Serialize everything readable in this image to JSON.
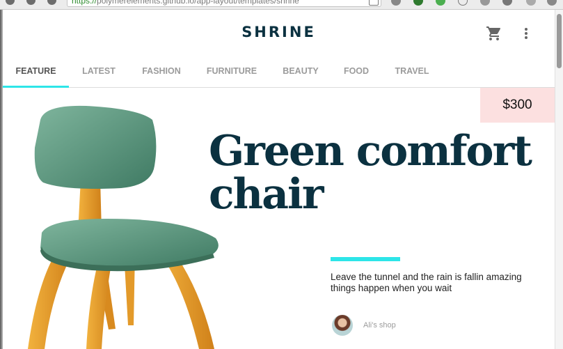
{
  "browser": {
    "url_scheme": "https://",
    "url_rest": "polymerelements.github.io/app-layout/templates/shrine"
  },
  "header": {
    "logo": "SHRINE",
    "cart_icon": "cart-icon",
    "more_icon": "more-vert-icon"
  },
  "tabs": [
    {
      "label": "FEATURE",
      "active": true
    },
    {
      "label": "LATEST",
      "active": false
    },
    {
      "label": "FASHION",
      "active": false
    },
    {
      "label": "FURNITURE",
      "active": false
    },
    {
      "label": "BEAUTY",
      "active": false
    },
    {
      "label": "FOOD",
      "active": false
    },
    {
      "label": "TRAVEL",
      "active": false
    }
  ],
  "feature": {
    "price": "$300",
    "title": "Green comfort chair",
    "description": "Leave the tunnel and the rain is fallin amazing things happen when you wait",
    "shop": "Ali's shop"
  },
  "colors": {
    "accent": "#2de5e8",
    "title": "#0b3140",
    "price_bg": "#fce0e0",
    "chair_seat": "#5e9b83",
    "chair_wood": "#e89b2c"
  }
}
